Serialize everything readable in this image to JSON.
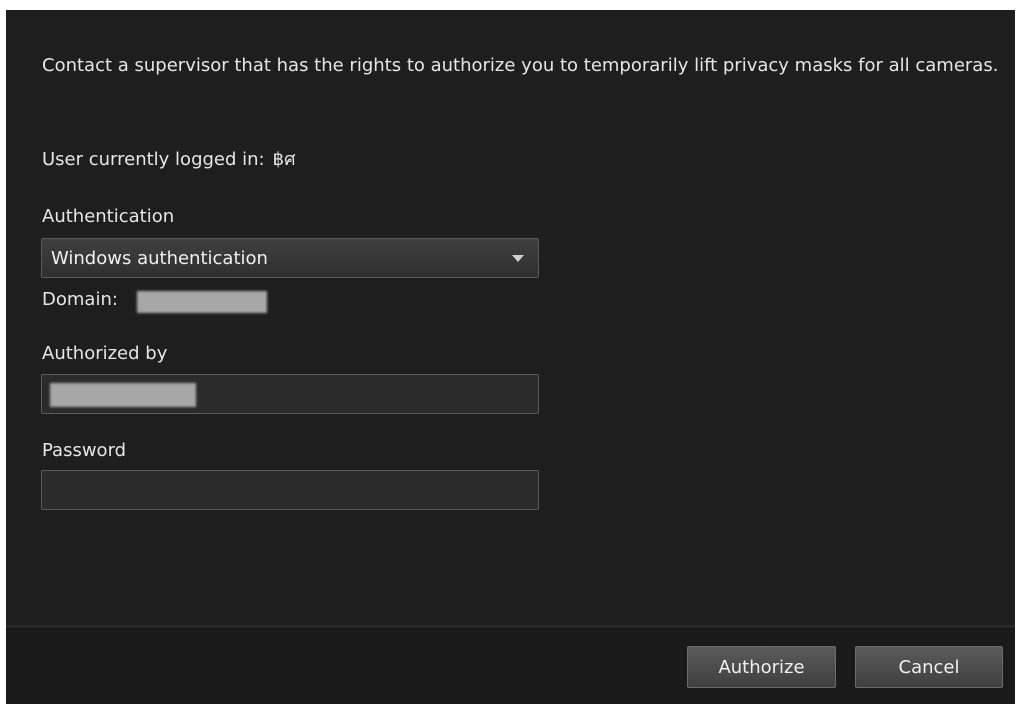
{
  "dialog": {
    "intro_text": "Contact a supervisor that has the rights to authorize you to temporarily lift privacy masks for all cameras.",
    "user_label": "User currently logged in:",
    "user_value": "฿ศ",
    "authentication": {
      "label": "Authentication",
      "selected": "Windows authentication"
    },
    "domain_label": "Domain:",
    "authorized_by": {
      "label": "Authorized by",
      "value": ""
    },
    "password": {
      "label": "Password",
      "value": ""
    }
  },
  "footer": {
    "authorize_label": "Authorize",
    "cancel_label": "Cancel"
  },
  "colors": {
    "dialog_bg": "#1e1e1e",
    "footer_bg": "#1a1a1a",
    "text": "#e6e6e6",
    "button_bg": "#4a4a4a"
  }
}
